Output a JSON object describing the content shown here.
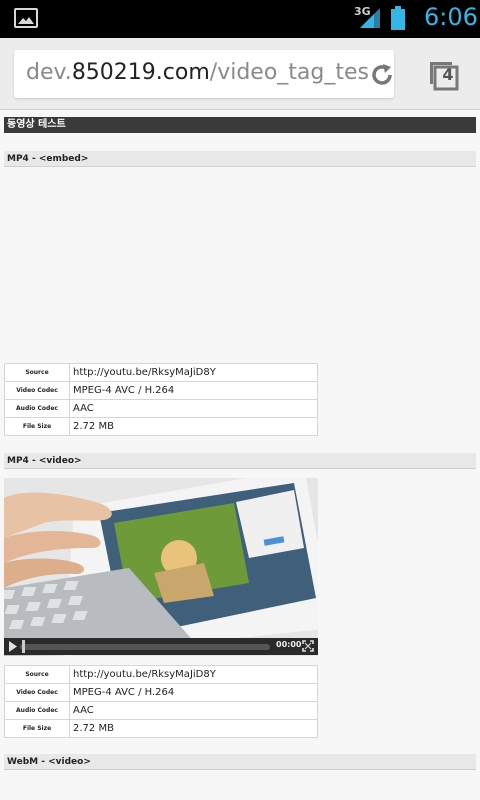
{
  "status_bar": {
    "network": "3G",
    "time": "6:06",
    "icons": [
      "gallery-icon",
      "signal-icon",
      "battery-icon"
    ]
  },
  "browser": {
    "url_prefix": "dev.",
    "url_host": "850219.com",
    "url_path": "/video_tag_tes",
    "tab_count": "4",
    "icons": [
      "refresh-icon",
      "tabs-icon"
    ]
  },
  "page": {
    "title": "동영상 테스트",
    "sections": [
      {
        "heading": "MP4 - <embed>",
        "rows": [
          {
            "key": "Source",
            "value": "http://youtu.be/RksyMaJiD8Y"
          },
          {
            "key": "Video Codec",
            "value": "MPEG-4 AVC / H.264"
          },
          {
            "key": "Audio Codec",
            "value": "AAC"
          },
          {
            "key": "File Size",
            "value": "2.72 MB"
          }
        ]
      },
      {
        "heading": "MP4 - <video>",
        "video_time": "00:00",
        "rows": [
          {
            "key": "Source",
            "value": "http://youtu.be/RksyMaJiD8Y"
          },
          {
            "key": "Video Codec",
            "value": "MPEG-4 AVC / H.264"
          },
          {
            "key": "Audio Codec",
            "value": "AAC"
          },
          {
            "key": "File Size",
            "value": "2.72 MB"
          }
        ]
      },
      {
        "heading": "WebM - <video>"
      }
    ]
  },
  "colors": {
    "accent": "#33b5e5",
    "title_bar": "#3a3a3a"
  }
}
